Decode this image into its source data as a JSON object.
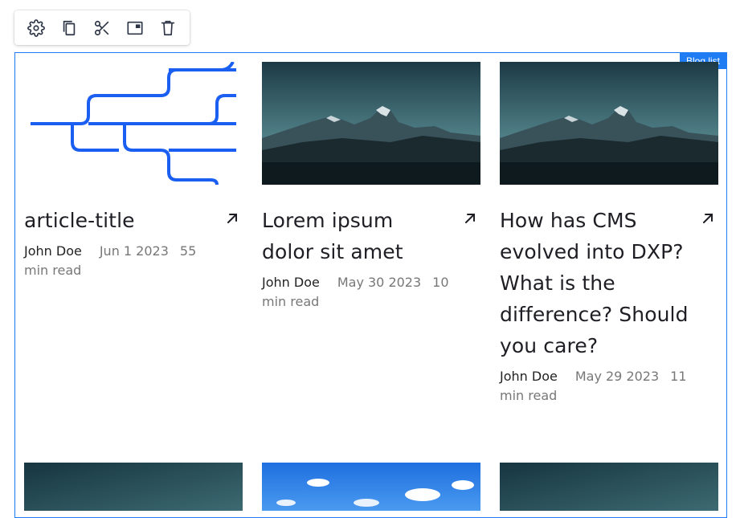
{
  "toolbar": {
    "buttons": [
      {
        "name": "settings",
        "icon": "gear-icon"
      },
      {
        "name": "duplicate",
        "icon": "copy-icon"
      },
      {
        "name": "cut",
        "icon": "scissors-icon"
      },
      {
        "name": "layout",
        "icon": "window-icon"
      },
      {
        "name": "delete",
        "icon": "trash-icon"
      }
    ]
  },
  "frame": {
    "label": "Blog list",
    "accent_color": "#1f7cf2"
  },
  "cards": [
    {
      "title": "article-title",
      "author": "John Doe",
      "date": "Jun 1 2023",
      "read_time": "55 min read",
      "image": "pipeline-diagram"
    },
    {
      "title": "Lorem ipsum dolor sit amet",
      "author": "John Doe",
      "date": "May 30 2023",
      "read_time": "10 min read",
      "image": "mountain-photo"
    },
    {
      "title": "How has CMS evolved into DXP? What is the difference? Should you care?",
      "author": "John Doe",
      "date": "May 29 2023",
      "read_time": "11 min read",
      "image": "mountain-photo"
    }
  ],
  "bottom_cards": [
    {
      "image": "teal-gradient"
    },
    {
      "image": "blue-sky-clouds"
    },
    {
      "image": "teal-gradient"
    }
  ]
}
